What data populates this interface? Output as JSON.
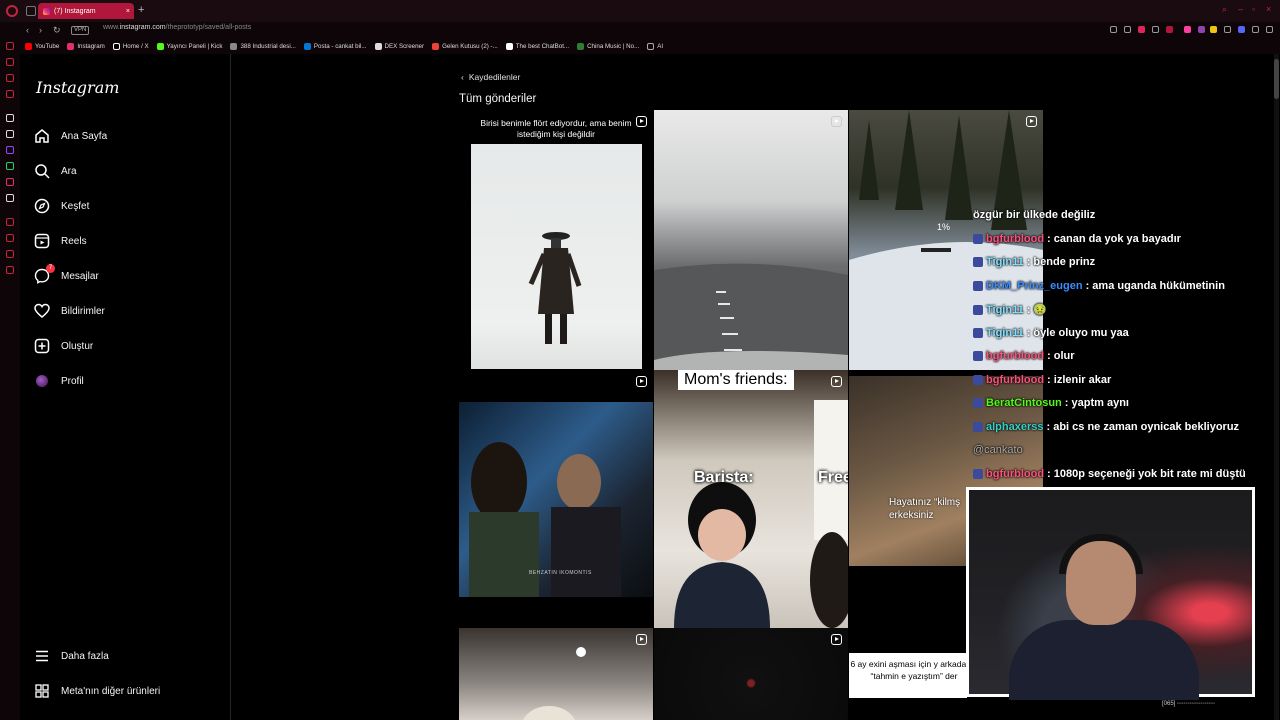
{
  "browser": {
    "tab_title": "(7) Instagram",
    "url_prefix": "www.",
    "url_host": "instagram.com",
    "url_path": "/theprototyp/saved/all-posts",
    "vpn_label": "VPN",
    "bookmarks": [
      {
        "label": "YouTube",
        "color": "#ff0000"
      },
      {
        "label": "Instagram",
        "color": "#e1306c"
      },
      {
        "label": "Home / X",
        "color": "#ffffff"
      },
      {
        "label": "Yayıncı Paneli | Kick",
        "color": "#53fc18"
      },
      {
        "label": "388 Industrial desi...",
        "color": "#888888"
      },
      {
        "label": "Posta - cankat bil...",
        "color": "#0078d4"
      },
      {
        "label": "DEX Screener",
        "color": "#dddddd"
      },
      {
        "label": "Gelen Kutusu (2) -...",
        "color": "#ea4335"
      },
      {
        "label": "The best ChatBot...",
        "color": "#ffffff"
      },
      {
        "label": "China Music | No...",
        "color": "#2e7d32"
      },
      {
        "label": "AI",
        "color": "#aaaaaa"
      }
    ]
  },
  "instagram": {
    "logo": "Instagram",
    "nav": [
      {
        "label": "Ana Sayfa",
        "icon": "home-icon"
      },
      {
        "label": "Ara",
        "icon": "search-icon"
      },
      {
        "label": "Keşfet",
        "icon": "compass-icon"
      },
      {
        "label": "Reels",
        "icon": "reels-icon"
      },
      {
        "label": "Mesajlar",
        "icon": "messenger-icon",
        "badge": "7"
      },
      {
        "label": "Bildirimler",
        "icon": "heart-icon"
      },
      {
        "label": "Oluştur",
        "icon": "plus-square-icon"
      },
      {
        "label": "Profil",
        "icon": "avatar"
      }
    ],
    "more": "Daha fazla",
    "meta": "Meta'nın diğer ürünleri",
    "back_label": "Kaydedilenler",
    "page_title": "Tüm gönderiler",
    "posts": {
      "p1_caption": "Birisi benimle flört ediyordur, ama benim istediğim kişi değildir",
      "p4_watermark": "BEHZATIN IKOMONTIS",
      "p5_top": "Mom's friends:",
      "p5_left": "Barista:",
      "p5_right": "Free",
      "p3_overlay": "1%",
      "p6_caption_1": "Hayatınız “kilmş",
      "p6_caption_2": "erkeksiniz",
      "p9_caption": "6 ay exini aşması için y arkadaşın “tahmin e yazıştım” der"
    }
  },
  "chat": {
    "header": "özgür bir ülkede değiliz",
    "messages": [
      {
        "user": "bgfurblood",
        "color": "#ff4f7b",
        "text": ": canan da yok ya bayadır"
      },
      {
        "user": "Tigin11",
        "color": "#7fe0ff",
        "text": ": bende prinz"
      },
      {
        "user": "DKM_Prinz_eugen",
        "color": "#3b8cff",
        "text": ": ama uganda hükümetinin"
      },
      {
        "user": "Tigin11",
        "color": "#7fe0ff",
        "text": ": 🤢"
      },
      {
        "user": "Tigin11",
        "color": "#7fe0ff",
        "text": ": öyle oluyo mu yaa"
      },
      {
        "user": "bgfurblood",
        "color": "#ff4f7b",
        "text": ": olur"
      },
      {
        "user": "bgfurblood",
        "color": "#ff4f7b",
        "text": ": izlenir akar"
      },
      {
        "user": "BeratCintosun",
        "color": "#53fc18",
        "text": ": yaptm aynı"
      },
      {
        "user": "alphaxerss",
        "color": "#35d0c8",
        "text": ": abi cs ne zaman oynicak bekliyoruz"
      },
      {
        "user": "",
        "color": "#aaaaaa",
        "text": "@cankato"
      },
      {
        "user": "bgfurblood",
        "color": "#ff4f7b",
        "text": ": 1080p seçeneği yok bit rate mi düştü"
      }
    ]
  },
  "status": {
    "text": "[065] ◦◦◦◦◦◦◦◦◦◦◦◦◦◦◦◦◦◦"
  }
}
